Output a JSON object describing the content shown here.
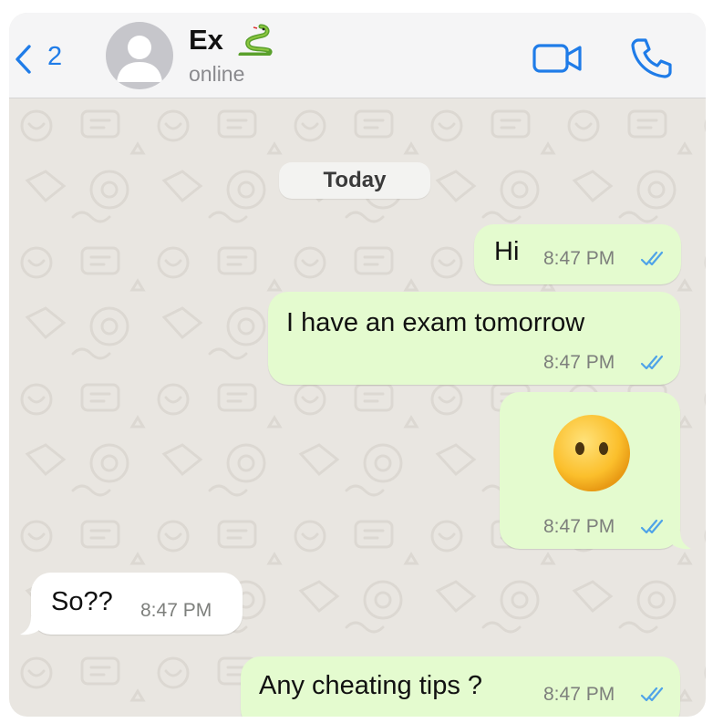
{
  "header": {
    "back_count": "2",
    "contact_name": "Ex",
    "contact_status": "online"
  },
  "chat": {
    "date_label": "Today",
    "messages": [
      {
        "direction": "outgoing",
        "text": "Hi",
        "time": "8:47 PM",
        "read": true
      },
      {
        "direction": "outgoing",
        "text": "I have an exam tomorrow",
        "time": "8:47 PM",
        "read": true
      },
      {
        "direction": "outgoing",
        "emoji": "face-without-mouth",
        "time": "8:47 PM",
        "read": true
      },
      {
        "direction": "incoming",
        "text": "So??",
        "time": "8:47 PM"
      },
      {
        "direction": "outgoing",
        "text": "Any cheating tips ?",
        "time": "8:47 PM",
        "read": true
      }
    ]
  },
  "colors": {
    "accent": "#1f7ce8",
    "outgoing_bubble": "#e4fbcf",
    "incoming_bubble": "#ffffff",
    "chat_background": "#e9e6e1",
    "read_ticks": "#4fa3e8"
  }
}
